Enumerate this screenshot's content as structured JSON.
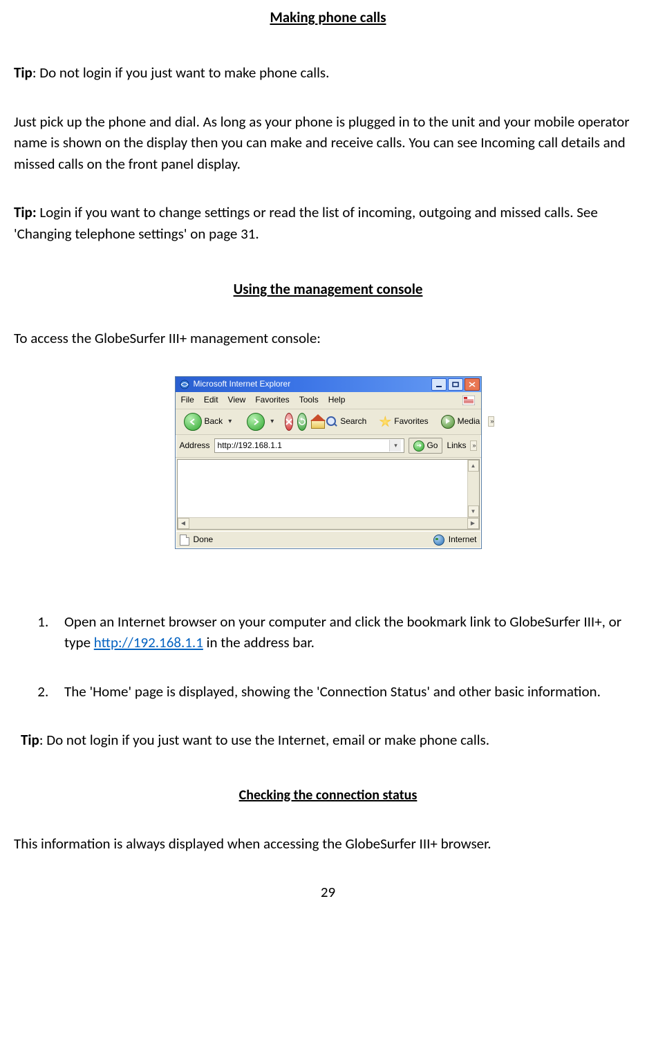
{
  "headings": {
    "making_calls": "Making phone calls",
    "console": "Using the management console",
    "checking": "Checking the connection status"
  },
  "tip_label": "Tip",
  "tip_bold_label": "Tip:",
  "paras": {
    "tip1_text": ": Do not login if you just want to make phone calls.",
    "para1": "Just pick up the phone and dial. As long as your phone is plugged in to the unit and your mobile operator name is shown on the display then you can make and receive calls. You can see Incoming call details and missed calls on the front panel display.",
    "tip2_text": " Login if you want to change settings or read the list of incoming, outgoing and missed calls. See 'Changing telephone settings' on page 31.",
    "console_intro": "To access the GlobeSurfer III+ management console:",
    "step1_pre": "Open an Internet browser on your computer and click the bookmark link to GlobeSurfer III+, or type ",
    "step1_link": "http://192.168.1.1",
    "step1_post": "  in the address bar.",
    "step2": "The 'Home' page is displayed, showing the 'Connection Status' and other basic information.",
    "tip3_text": ": Do not login if you just want to use the Internet, email or make phone calls.",
    "checking_para": "This information is always displayed when accessing the GlobeSurfer III+ browser."
  },
  "page_number": "29",
  "ie": {
    "title": "Microsoft Internet Explorer",
    "menu": {
      "file": "File",
      "edit": "Edit",
      "view": "View",
      "favorites": "Favorites",
      "tools": "Tools",
      "help": "Help"
    },
    "toolbar": {
      "back": "Back",
      "search": "Search",
      "favorites": "Favorites",
      "media": "Media"
    },
    "address_label": "Address",
    "address_value": "http://192.168.1.1",
    "go": "Go",
    "links": "Links",
    "status_done": "Done",
    "status_zone": "Internet"
  }
}
